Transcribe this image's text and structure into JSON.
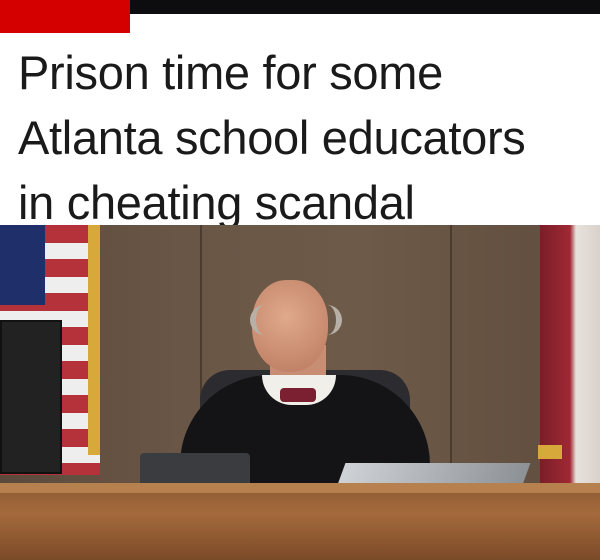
{
  "header": {
    "accent_color": "#d40000",
    "bar_color": "#0d0d10"
  },
  "headline": {
    "lines": [
      "Prison time for some",
      "Atlanta school educators",
      "in cheating scandal"
    ]
  },
  "photo": {
    "subject": "judge-at-bench"
  }
}
